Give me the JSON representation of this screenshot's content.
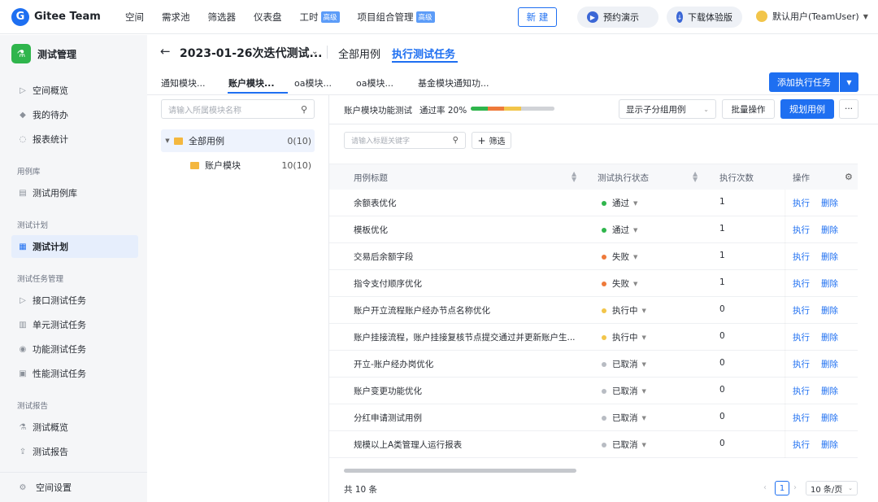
{
  "nav": {
    "logo": "Gitee Team",
    "items": [
      {
        "label": "空间",
        "badge": ""
      },
      {
        "label": "需求池",
        "badge": ""
      },
      {
        "label": "筛选器",
        "badge": ""
      },
      {
        "label": "仪表盘",
        "badge": ""
      },
      {
        "label": "工时",
        "badge": "高级"
      },
      {
        "label": "项目组合管理",
        "badge": "高级"
      }
    ],
    "new_button": "新 建",
    "demo_button": "预约演示",
    "download_button": "下载体验版",
    "user_name": "默认用户(TeamUser)"
  },
  "sidebar": {
    "title": "测试管理",
    "items": [
      {
        "label": "空间概览",
        "icon": "play-icon"
      },
      {
        "label": "我的待办",
        "icon": "tag-icon"
      },
      {
        "label": "报表统计",
        "icon": "chart-ring-icon"
      }
    ],
    "sections": [
      {
        "label": "用例库",
        "items": [
          {
            "label": "测试用例库",
            "icon": "library-icon"
          }
        ]
      },
      {
        "label": "测试计划",
        "items": [
          {
            "label": "测试计划",
            "icon": "plan-icon",
            "active": true
          }
        ]
      },
      {
        "label": "测试任务管理",
        "items": [
          {
            "label": "接口测试任务",
            "icon": "play-icon"
          },
          {
            "label": "单元测试任务",
            "icon": "grid-icon"
          },
          {
            "label": "功能测试任务",
            "icon": "person-icon"
          },
          {
            "label": "性能测试任务",
            "icon": "doc-icon"
          }
        ]
      },
      {
        "label": "测试报告",
        "items": [
          {
            "label": "测试概览",
            "icon": "flask-icon"
          },
          {
            "label": "测试报告",
            "icon": "upload-icon"
          }
        ]
      }
    ],
    "footer": "空间设置"
  },
  "header": {
    "title": "2023-01-26次迭代测试...",
    "tab_all": "全部用例",
    "tab_exec": "执行测试任务"
  },
  "subtabs": [
    "通知模块...",
    "账户模块...",
    "oa模块...",
    "oa模块...",
    "基金模块通知功..."
  ],
  "add_task_button": "添加执行任务",
  "tree": {
    "search_placeholder": "请输入所属模块名称",
    "nodes": [
      {
        "label": "全部用例",
        "count": "0(10)"
      },
      {
        "label": "账户模块",
        "count": "10(10)"
      }
    ]
  },
  "panel": {
    "module_label": "账户模块功能测试",
    "pass_rate": "通过率 20%",
    "progress": {
      "pass": 0.2,
      "fail": 0.2,
      "running": 0.2,
      "cancelled": 0.4
    },
    "subgroup_select": "显示子分组用例",
    "batch_button": "批量操作",
    "plan_button": "规划用例",
    "more_button": "···",
    "case_search_placeholder": "请输入标题关键字",
    "filter_button": "筛选"
  },
  "table": {
    "headers": {
      "title": "用例标题",
      "status": "测试执行状态",
      "count": "执行次数",
      "ops": "操作"
    },
    "rows": [
      {
        "title": "余额表优化",
        "status": "通过",
        "color": "#2fb54c",
        "count": "1"
      },
      {
        "title": "模板优化",
        "status": "通过",
        "color": "#2fb54c",
        "count": "1"
      },
      {
        "title": "交易后余额字段",
        "status": "失败",
        "color": "#ee7a3a",
        "count": "1"
      },
      {
        "title": "指令支付顺序优化",
        "status": "失败",
        "color": "#ee7a3a",
        "count": "1"
      },
      {
        "title": "账户开立流程账户经办节点名称优化",
        "status": "执行中",
        "color": "#f2c54a",
        "count": "0"
      },
      {
        "title": "账户挂接流程，账户挂接复核节点提交通过并更新账户生...",
        "status": "执行中",
        "color": "#f2c54a",
        "count": "0"
      },
      {
        "title": "开立-账户经办岗优化",
        "status": "已取消",
        "color": "#b8bcc3",
        "count": "0"
      },
      {
        "title": "账户变更功能优化",
        "status": "已取消",
        "color": "#b8bcc3",
        "count": "0"
      },
      {
        "title": "分红申请测试用例",
        "status": "已取消",
        "color": "#b8bcc3",
        "count": "0"
      },
      {
        "title": "规模以上A类管理人运行报表",
        "status": "已取消",
        "color": "#b8bcc3",
        "count": "0"
      }
    ],
    "exec_label": "执行",
    "delete_label": "删除"
  },
  "footer": {
    "total": "共 10 条",
    "page": "1",
    "page_size": "10 条/页"
  }
}
